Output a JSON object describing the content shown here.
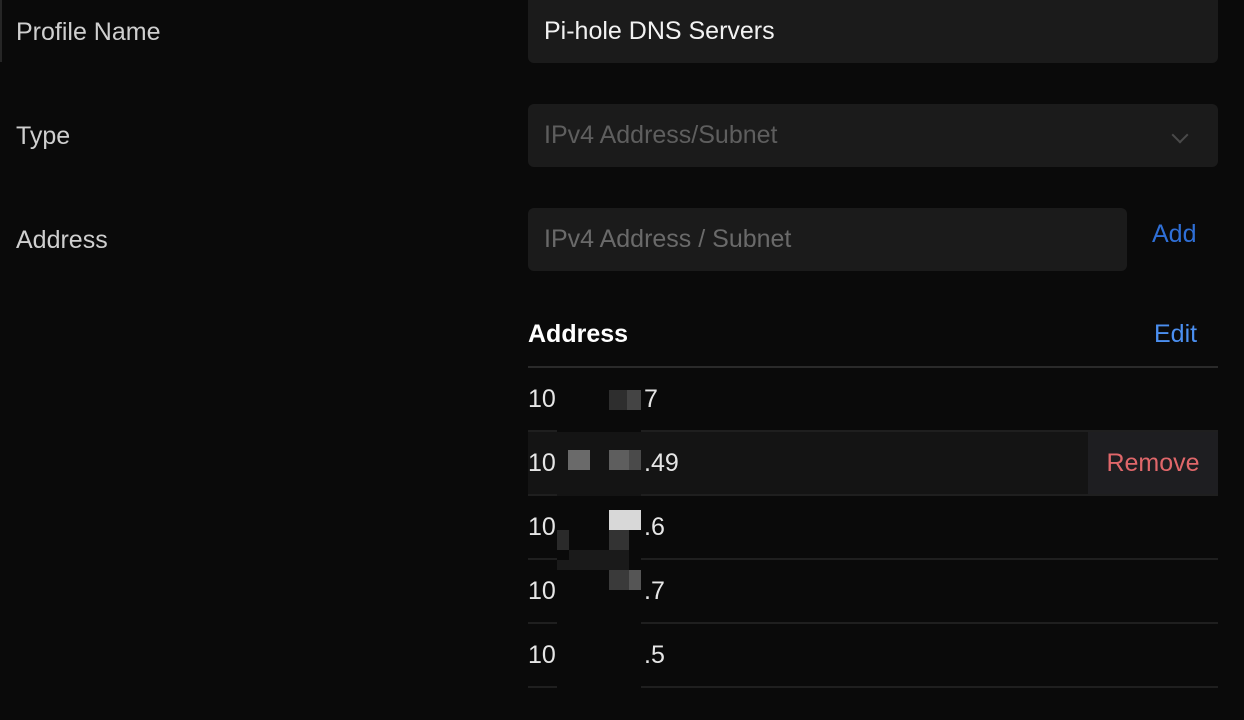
{
  "form": {
    "profile_name_label": "Profile Name",
    "profile_name_value": "Pi-hole DNS Servers",
    "type_label": "Type",
    "type_value": "IPv4 Address/Subnet",
    "address_label": "Address",
    "address_placeholder": "IPv4 Address / Subnet",
    "add_label": "Add"
  },
  "table": {
    "header": "Address",
    "edit_label": "Edit",
    "remove_label": "Remove",
    "rows": [
      {
        "prefix": "10",
        "suffix": "7"
      },
      {
        "prefix": "10",
        "suffix": ".49"
      },
      {
        "prefix": "10",
        "suffix": ".6"
      },
      {
        "prefix": "10",
        "suffix": ".7"
      },
      {
        "prefix": "10",
        "suffix": ".5"
      }
    ]
  },
  "colors": {
    "background": "#0a0a0a",
    "input_background": "#1b1b1b",
    "link": "#3f82e6",
    "remove": "#e0676a"
  }
}
